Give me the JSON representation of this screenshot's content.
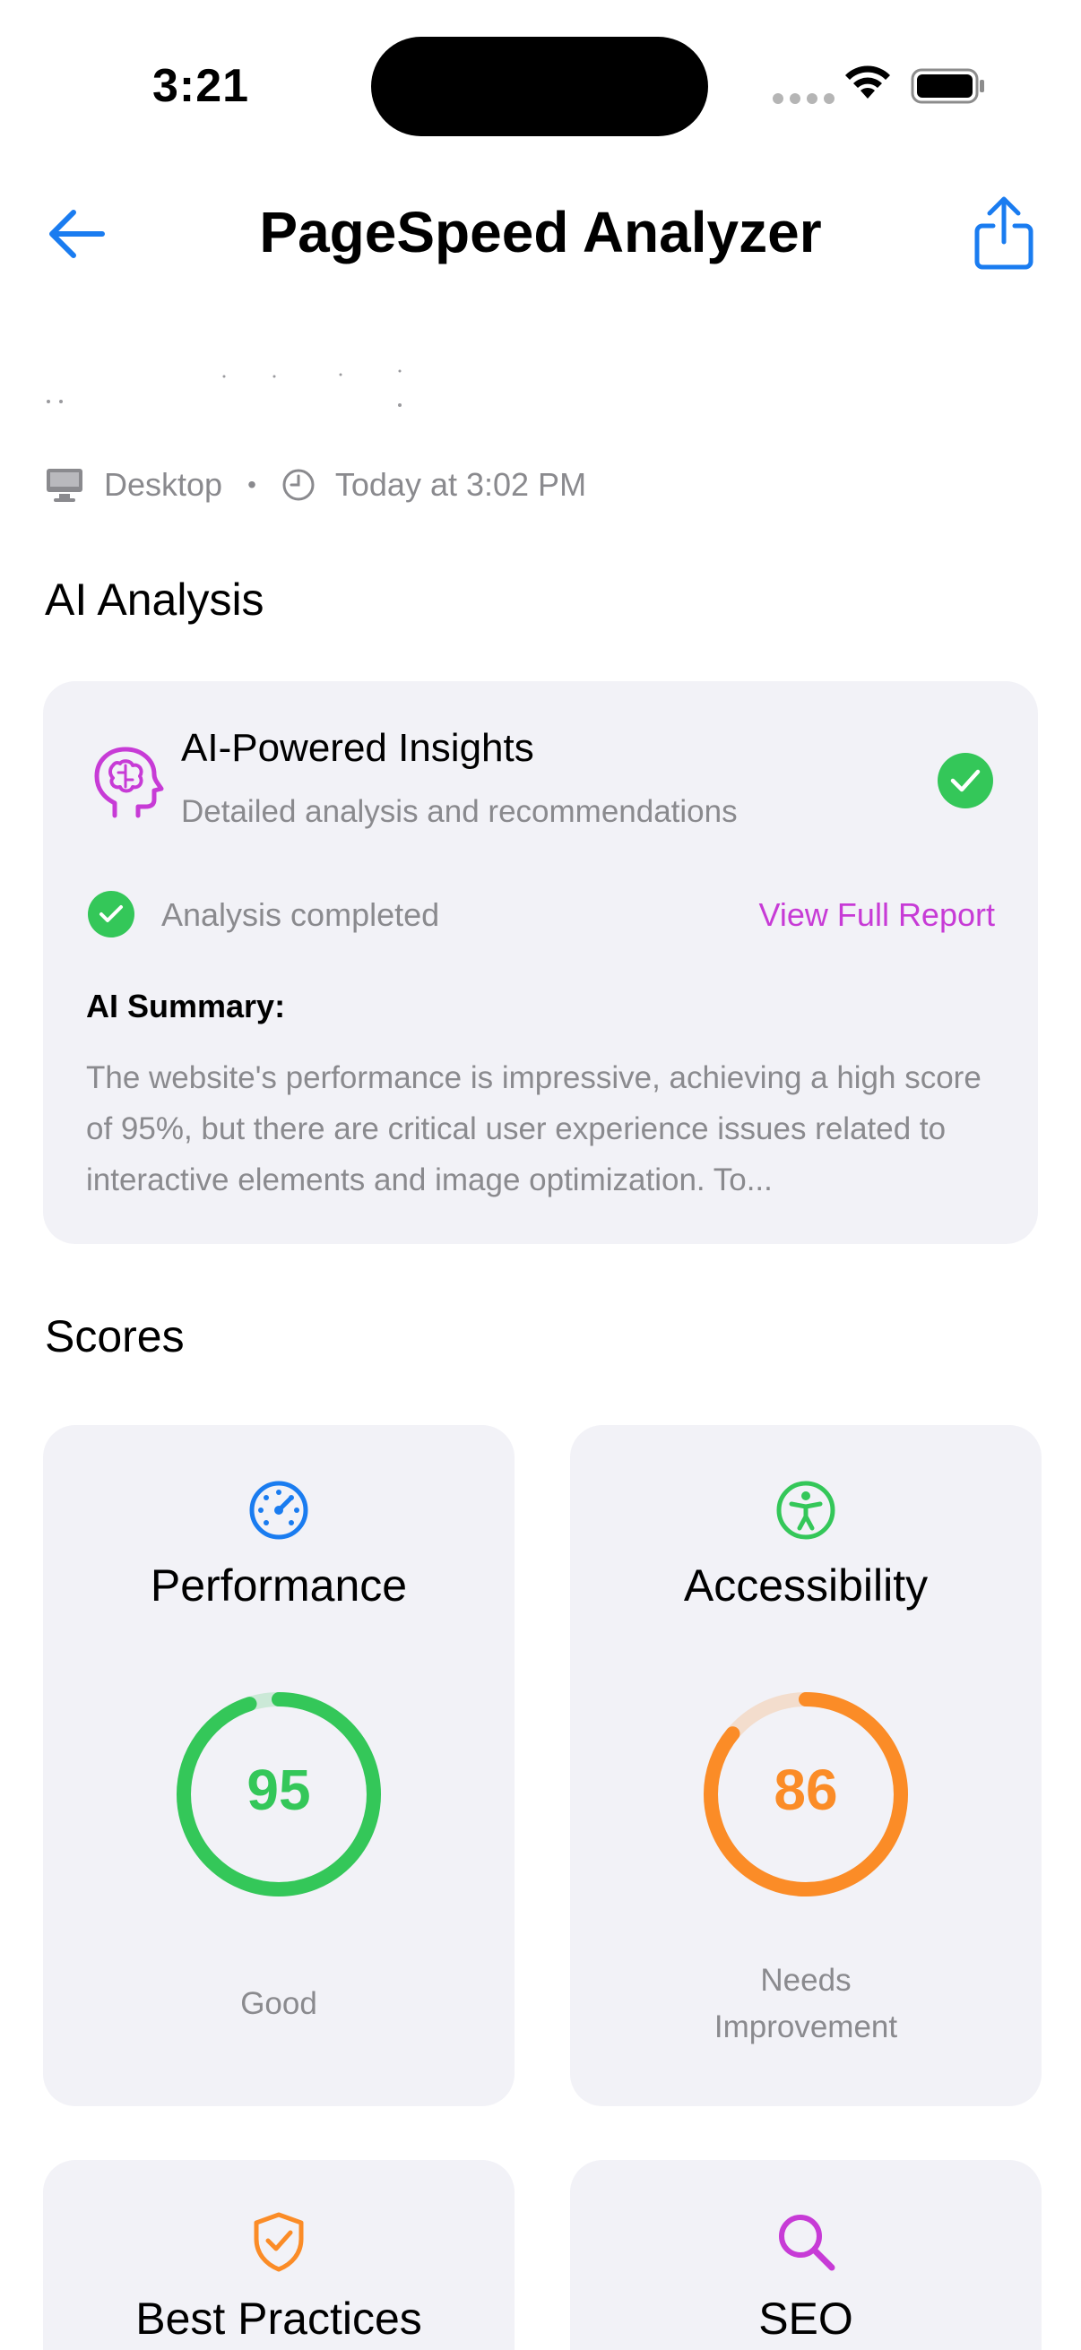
{
  "status_bar": {
    "time": "3:21"
  },
  "nav": {
    "title": "PageSpeed Analyzer",
    "back_icon": "arrow-left-icon",
    "share_icon": "share-icon"
  },
  "meta": {
    "device": "Desktop",
    "separator": "•",
    "timestamp": "Today at 3:02 PM"
  },
  "sections": {
    "ai_title": "AI Analysis",
    "scores_title": "Scores"
  },
  "ai_card": {
    "title": "AI-Powered Insights",
    "subtitle": "Detailed analysis and recommendations",
    "status": "Analysis completed",
    "link": "View Full Report",
    "summary_label": "AI Summary:",
    "summary": "The website's performance is impressive, achieving a high score of 95%, but there are critical user experience issues related to interactive elements and image optimization. To..."
  },
  "colors": {
    "accent": "#1a7cf0",
    "ai_purple": "#c73bd6",
    "good": "#34c759",
    "warn": "#fb8c27"
  },
  "scores": [
    {
      "label": "Performance",
      "value": "95",
      "status": "Good",
      "icon": "speedometer-icon",
      "color": "#34c759",
      "fraction": 0.95
    },
    {
      "label": "Accessibility",
      "value": "86",
      "status": "Needs Improvement",
      "icon": "accessibility-icon",
      "color": "#fb8c27",
      "fraction": 0.86
    },
    {
      "label": "Best Practices",
      "icon": "shield-check-icon",
      "color": "#fb8c27"
    },
    {
      "label": "SEO",
      "icon": "magnifying-glass-icon",
      "color": "#c73bd6"
    }
  ]
}
